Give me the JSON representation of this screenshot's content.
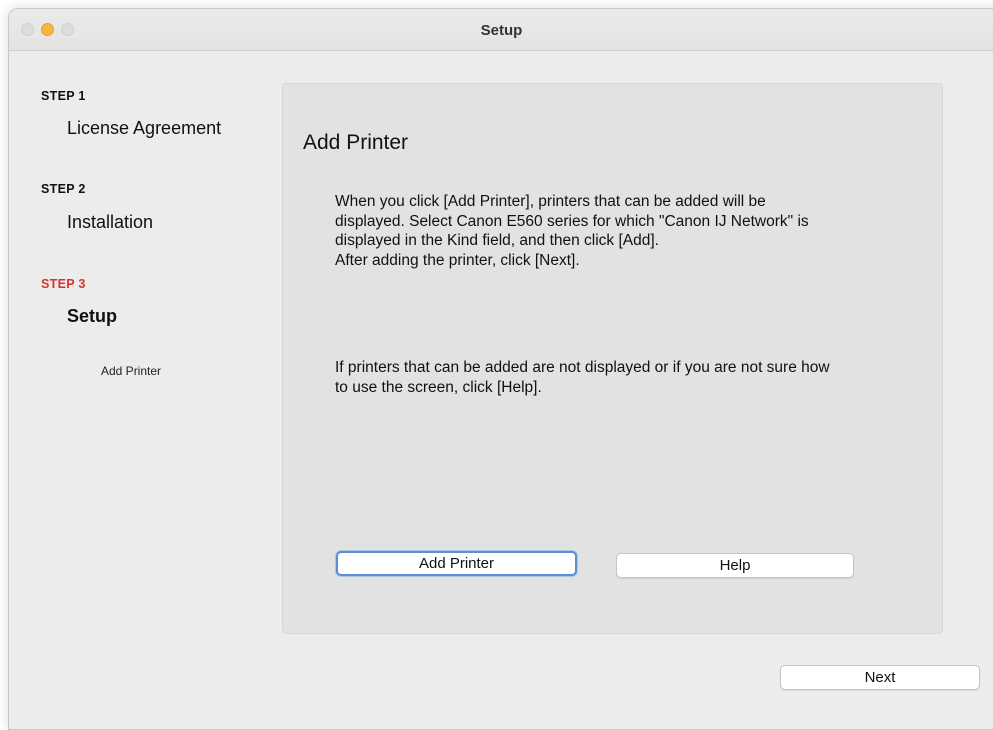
{
  "window": {
    "title": "Setup"
  },
  "sidebar": {
    "steps": [
      {
        "step_label": "STEP 1",
        "name": "License Agreement"
      },
      {
        "step_label": "STEP 2",
        "name": "Installation"
      },
      {
        "step_label": "STEP 3",
        "name": "Setup",
        "substep": "Add Printer"
      }
    ]
  },
  "main": {
    "title": "Add Printer",
    "instructions": "When you click [Add Printer], printers that can be added will be\ndisplayed. Select Canon E560 series for which \"Canon IJ Network\" is\ndisplayed in the Kind field, and then click [Add].\nAfter adding the printer, click [Next].",
    "help_note": "If printers that can be added are not displayed or if you are not sure how\nto use the screen, click [Help].",
    "add_printer_button": "Add Printer",
    "help_button": "Help"
  },
  "footer": {
    "next_button": "Next"
  },
  "colors": {
    "active_step": "#e0302a",
    "focus_ring": "#5b8fd9"
  }
}
